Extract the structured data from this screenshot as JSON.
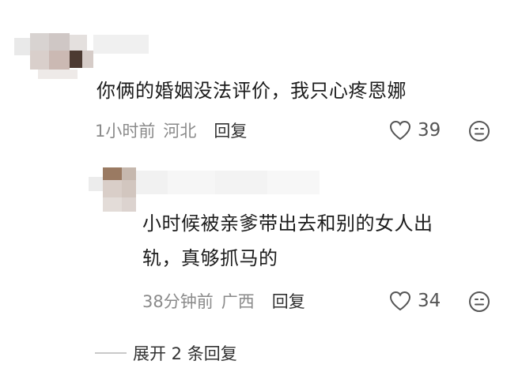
{
  "comment": {
    "text": "你俩的婚姻没法评价，我只心疼恩娜",
    "time": "1小时前",
    "location": "河北",
    "reply_label": "回复",
    "likes": "39",
    "like_icon": "heart-outline-icon",
    "emoji_icon": "smiley-face-icon"
  },
  "reply": {
    "text_line1": "小时候被亲爹带出去和别的女人出",
    "text_line2": "轨，真够抓马的",
    "time": "38分钟前",
    "location": "广西",
    "reply_label": "回复",
    "likes": "34",
    "like_icon": "heart-outline-icon",
    "emoji_icon": "smiley-face-icon"
  },
  "expand": {
    "label": "展开 2 条回复"
  }
}
